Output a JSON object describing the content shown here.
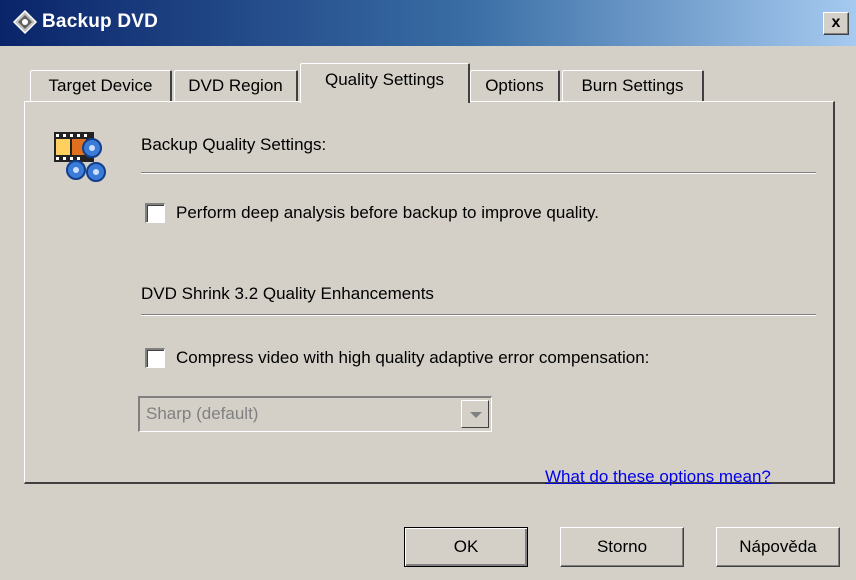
{
  "window": {
    "title": "Backup DVD",
    "close_label": "x",
    "title_icon": "dvd-shrink-app-icon"
  },
  "tabs": [
    {
      "label": "Target Device",
      "active": false
    },
    {
      "label": "DVD Region",
      "active": false
    },
    {
      "label": "Quality Settings",
      "active": true
    },
    {
      "label": "Options",
      "active": false
    },
    {
      "label": "Burn Settings",
      "active": false
    }
  ],
  "panel": {
    "icon": "film-gears-icon",
    "section1_heading": "Backup Quality Settings:",
    "deep_analysis": {
      "label": "Perform deep analysis before backup to improve quality.",
      "checked": false
    },
    "section2_heading": "DVD Shrink 3.2 Quality Enhancements",
    "compress": {
      "label": "Compress video with high quality adaptive error compensation:",
      "checked": false
    },
    "quality_select": {
      "value": "Sharp (default)",
      "disabled": true
    },
    "help_link": "What do these options mean?"
  },
  "buttons": {
    "ok": "OK",
    "cancel": "Storno",
    "help": "Nápověda"
  },
  "colors": {
    "titlebar_start": "#0a246a",
    "titlebar_end": "#a6caf0",
    "face": "#d4d0c8",
    "link": "#0000ee"
  }
}
